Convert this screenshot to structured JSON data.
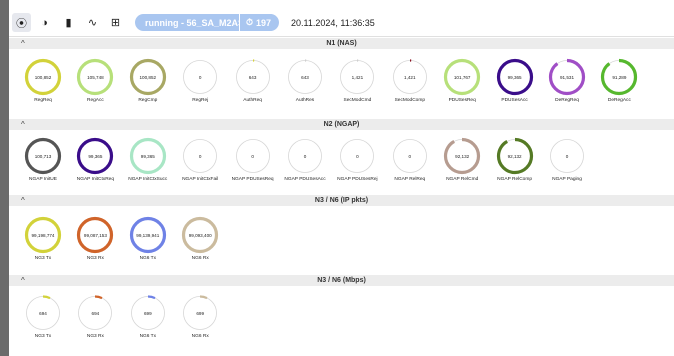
{
  "toolbar": {
    "buttons": [
      {
        "name": "record-icon",
        "glyph": "⦿",
        "active": true
      },
      {
        "name": "half-circle-icon",
        "glyph": "◑",
        "active": false
      },
      {
        "name": "bar-chart-icon",
        "glyph": "▮",
        "active": false
      },
      {
        "name": "line-chart-icon",
        "glyph": "∿",
        "active": false
      },
      {
        "name": "grid-icon",
        "glyph": "⊞",
        "active": false
      }
    ],
    "status_label": "running - 56_SA_M2AS_UDP",
    "counter_icon": "⏱",
    "counter_value": "197",
    "timestamp": "20.11.2024, 11:36:35"
  },
  "colors": {
    "yellow": "#d2d23a",
    "light_green": "#b7e07a",
    "olive": "#a8a864",
    "gray_ring": "#cfcfcf",
    "dark_gray": "#555555",
    "purple": "#3a0d8a",
    "violet": "#a04ec6",
    "green": "#56b82e",
    "mint": "#a8e6c5",
    "brown": "#b69c90",
    "dark_green": "#557a25",
    "orange": "#d0642a",
    "blue": "#6f82e6",
    "tan": "#cbbb9e",
    "marker_yellow": "#d8d43a",
    "marker_red": "#8a1020",
    "marker_blue": "#2b2bb0"
  },
  "sections": [
    {
      "title": "N1 (NAS)",
      "gauges": [
        {
          "value": "100,852",
          "label": "RegReq",
          "color": "#d2d23a",
          "fill": 1.0
        },
        {
          "value": "105,748",
          "label": "RegAcc",
          "color": "#b7e07a",
          "fill": 1.0
        },
        {
          "value": "100,852",
          "label": "RegCmp",
          "color": "#a8a864",
          "fill": 1.0
        },
        {
          "value": "0",
          "label": "RegRej",
          "color": "#cfcfcf",
          "fill": 0
        },
        {
          "value": "643",
          "label": "AuthReq",
          "color": "#d8d43a",
          "fill": 0.01
        },
        {
          "value": "643",
          "label": "AuthRes",
          "color": "#cfcfcf",
          "fill": 0.005
        },
        {
          "value": "1,421",
          "label": "SecModCmd",
          "color": "#cfcfcf",
          "fill": 0.01
        },
        {
          "value": "1,421",
          "label": "SecModComp",
          "color": "#8a1020",
          "fill": 0.01
        },
        {
          "value": "101,767",
          "label": "PDUSesReq",
          "color": "#b7e07a",
          "fill": 1.0
        },
        {
          "value": "99,365",
          "label": "PDUSesAcc",
          "color": "#3a0d8a",
          "fill": 1.0
        },
        {
          "value": "91,531",
          "label": "DeRegReq",
          "color": "#a04ec6",
          "fill": 0.9
        },
        {
          "value": "91,289",
          "label": "DeRegAcc",
          "color": "#56b82e",
          "fill": 0.9
        }
      ]
    },
    {
      "title": "N2 (NGAP)",
      "gauges": [
        {
          "value": "100,713",
          "label": "NGAP InitUE",
          "color": "#555555",
          "fill": 1.0
        },
        {
          "value": "99,365",
          "label": "NGAP InitCtxReq",
          "color": "#3a0d8a",
          "fill": 1.0
        },
        {
          "value": "99,365",
          "label": "NGAP InitCtxSucc",
          "color": "#a8e6c5",
          "fill": 1.0
        },
        {
          "value": "0",
          "label": "NGAP InitCtxFail",
          "color": "#cfcfcf",
          "fill": 0
        },
        {
          "value": "0",
          "label": "NGAP PDUSesReq",
          "color": "#cfcfcf",
          "fill": 0
        },
        {
          "value": "0",
          "label": "NGAP PDUSesAcc",
          "color": "#cfcfcf",
          "fill": 0
        },
        {
          "value": "0",
          "label": "NGAP PDUSesRej",
          "color": "#cfcfcf",
          "fill": 0
        },
        {
          "value": "0",
          "label": "NGAP RelReq",
          "color": "#cfcfcf",
          "fill": 0
        },
        {
          "value": "92,132",
          "label": "NGAP RelCmd",
          "color": "#b69c90",
          "fill": 0.92
        },
        {
          "value": "92,132",
          "label": "NGAP RelComp",
          "color": "#557a25",
          "fill": 0.92
        },
        {
          "value": "0",
          "label": "NGAP Paging",
          "color": "#cfcfcf",
          "fill": 0
        }
      ]
    },
    {
      "title": "N3 / N6 (IP pkts)",
      "gauges": [
        {
          "value": "99,198,774",
          "label": "NG3 Tx",
          "color": "#d2d23a",
          "fill": 1.0
        },
        {
          "value": "99,087,153",
          "label": "NG3 Rx",
          "color": "#d0642a",
          "fill": 1.0
        },
        {
          "value": "99,139,941",
          "label": "NG6 Tx",
          "color": "#6f82e6",
          "fill": 1.0
        },
        {
          "value": "99,093,400",
          "label": "NG6 Rx",
          "color": "#cbbb9e",
          "fill": 1.0
        }
      ]
    },
    {
      "title": "N3 / N6 (Mbps)",
      "gauges": [
        {
          "value": "694",
          "label": "NG3 Tx",
          "color": "#d2d23a",
          "fill": 0.07
        },
        {
          "value": "694",
          "label": "NG3 Rx",
          "color": "#d0642a",
          "fill": 0.07
        },
        {
          "value": "699",
          "label": "NG6 Tx",
          "color": "#6f82e6",
          "fill": 0.07
        },
        {
          "value": "699",
          "label": "NG6 Rx",
          "color": "#cbbb9e",
          "fill": 0.07
        }
      ]
    }
  ]
}
